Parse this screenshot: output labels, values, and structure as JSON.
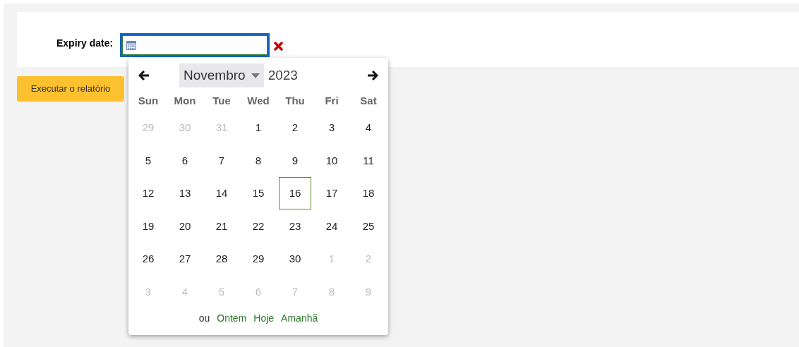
{
  "form": {
    "label": "Expiry date:",
    "date_field": {
      "focused": true
    }
  },
  "run_button": "Executar o relatório",
  "calendar": {
    "month": "Novembro",
    "year": "2023",
    "weekdays": [
      "Sun",
      "Mon",
      "Tue",
      "Wed",
      "Thu",
      "Fri",
      "Sat"
    ],
    "weeks": [
      [
        {
          "label": "29",
          "muted": true,
          "selected": false
        },
        {
          "label": "30",
          "muted": true,
          "selected": false
        },
        {
          "label": "31",
          "muted": true,
          "selected": false
        },
        {
          "label": "1",
          "muted": false,
          "selected": false
        },
        {
          "label": "2",
          "muted": false,
          "selected": false
        },
        {
          "label": "3",
          "muted": false,
          "selected": false
        },
        {
          "label": "4",
          "muted": false,
          "selected": false
        }
      ],
      [
        {
          "label": "5",
          "muted": false,
          "selected": false
        },
        {
          "label": "6",
          "muted": false,
          "selected": false
        },
        {
          "label": "7",
          "muted": false,
          "selected": false
        },
        {
          "label": "8",
          "muted": false,
          "selected": false
        },
        {
          "label": "9",
          "muted": false,
          "selected": false
        },
        {
          "label": "10",
          "muted": false,
          "selected": false
        },
        {
          "label": "11",
          "muted": false,
          "selected": false
        }
      ],
      [
        {
          "label": "12",
          "muted": false,
          "selected": false
        },
        {
          "label": "13",
          "muted": false,
          "selected": false
        },
        {
          "label": "14",
          "muted": false,
          "selected": false
        },
        {
          "label": "15",
          "muted": false,
          "selected": false
        },
        {
          "label": "16",
          "muted": false,
          "selected": true
        },
        {
          "label": "17",
          "muted": false,
          "selected": false
        },
        {
          "label": "18",
          "muted": false,
          "selected": false
        }
      ],
      [
        {
          "label": "19",
          "muted": false,
          "selected": false
        },
        {
          "label": "20",
          "muted": false,
          "selected": false
        },
        {
          "label": "21",
          "muted": false,
          "selected": false
        },
        {
          "label": "22",
          "muted": false,
          "selected": false
        },
        {
          "label": "23",
          "muted": false,
          "selected": false
        },
        {
          "label": "24",
          "muted": false,
          "selected": false
        },
        {
          "label": "25",
          "muted": false,
          "selected": false
        }
      ],
      [
        {
          "label": "26",
          "muted": false,
          "selected": false
        },
        {
          "label": "27",
          "muted": false,
          "selected": false
        },
        {
          "label": "28",
          "muted": false,
          "selected": false
        },
        {
          "label": "29",
          "muted": false,
          "selected": false
        },
        {
          "label": "30",
          "muted": false,
          "selected": false
        },
        {
          "label": "1",
          "muted": true,
          "selected": false
        },
        {
          "label": "2",
          "muted": true,
          "selected": false
        }
      ],
      [
        {
          "label": "3",
          "muted": true,
          "selected": false
        },
        {
          "label": "4",
          "muted": true,
          "selected": false
        },
        {
          "label": "5",
          "muted": true,
          "selected": false
        },
        {
          "label": "6",
          "muted": true,
          "selected": false
        },
        {
          "label": "7",
          "muted": true,
          "selected": false
        },
        {
          "label": "8",
          "muted": true,
          "selected": false
        },
        {
          "label": "9",
          "muted": true,
          "selected": false
        }
      ]
    ],
    "footer": {
      "text": "ou",
      "links": [
        "Ontem",
        "Hoje",
        "Amanhã"
      ]
    }
  }
}
